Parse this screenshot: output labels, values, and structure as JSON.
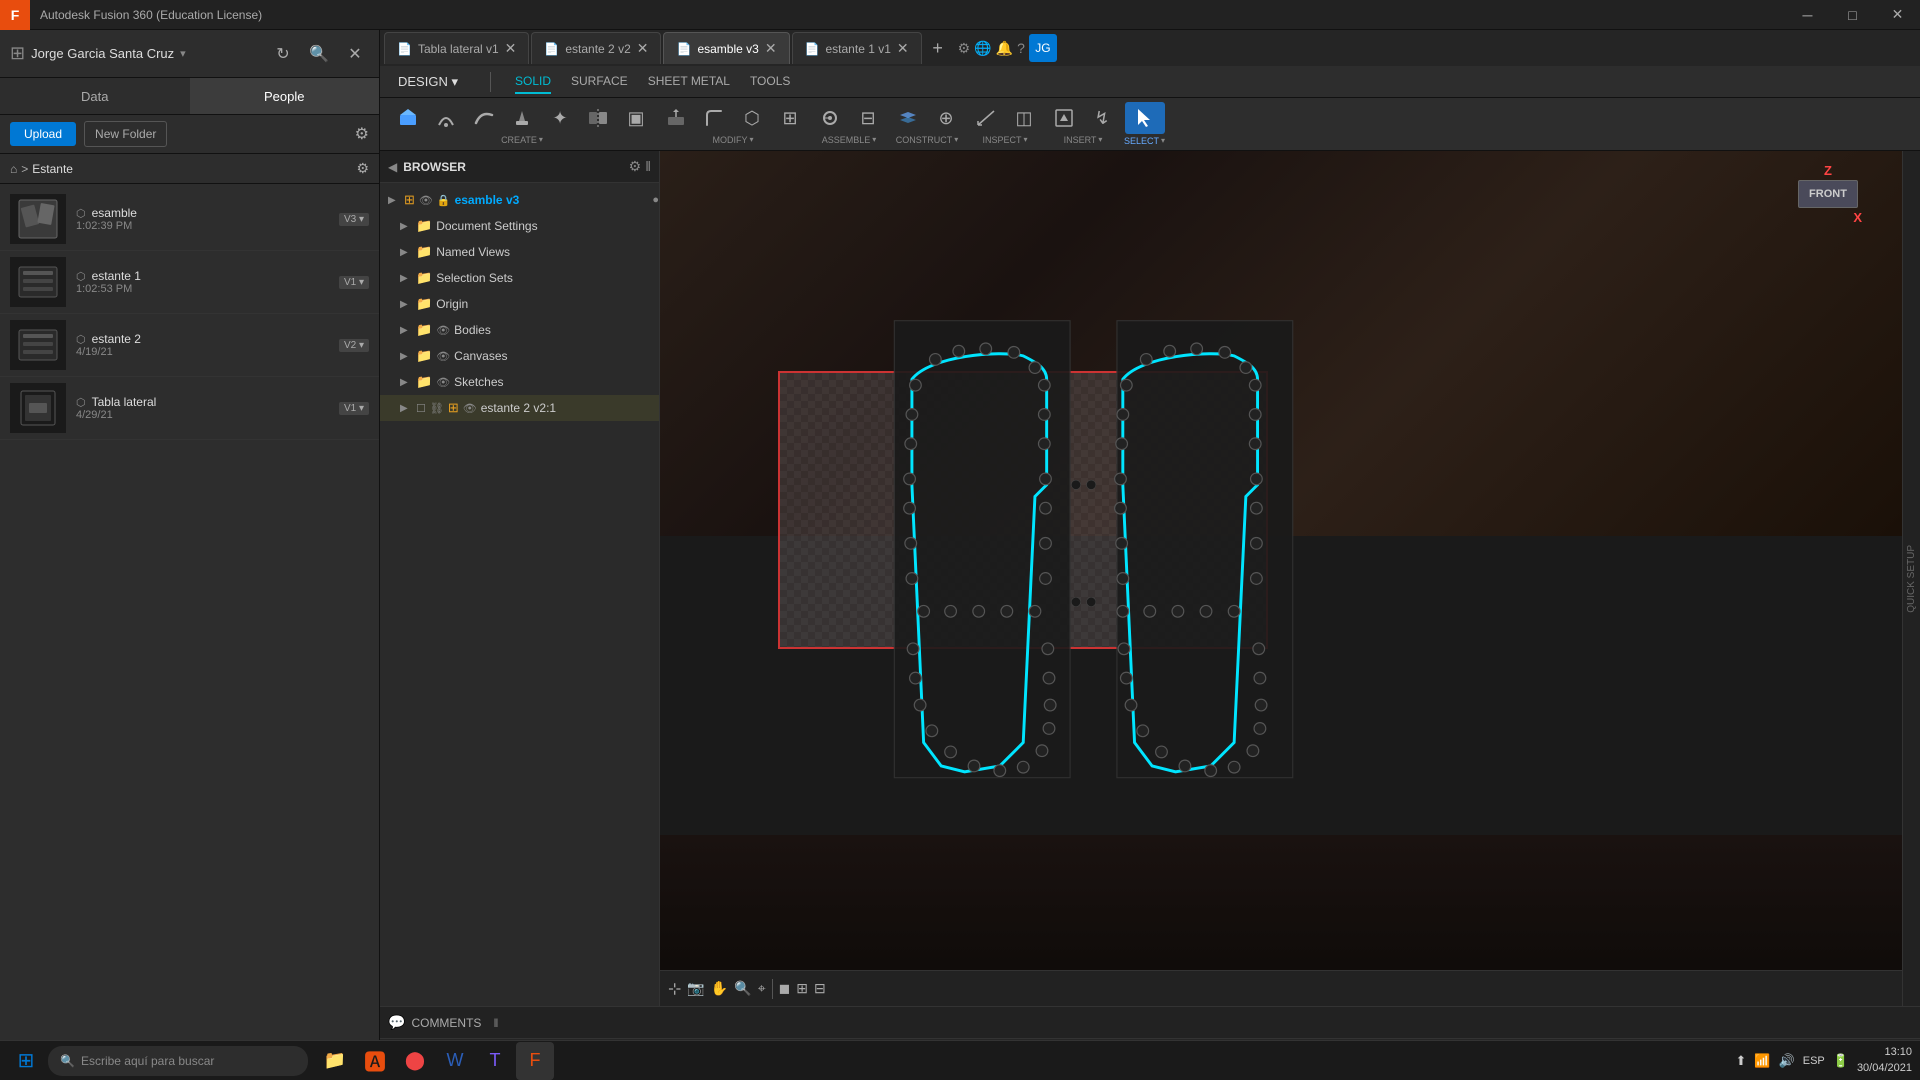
{
  "app": {
    "title": "Autodesk Fusion 360 (Education License)",
    "icon": "F"
  },
  "titlebar": {
    "title": "Autodesk Fusion 360 (Education License)",
    "minimize": "─",
    "maximize": "□",
    "close": "✕"
  },
  "user": {
    "name": "Jorge Garcia Santa Cruz",
    "caret": "▾"
  },
  "left_tabs": {
    "data": "Data",
    "people": "People"
  },
  "actions": {
    "upload": "Upload",
    "new_folder": "New Folder"
  },
  "breadcrumb": {
    "home": "⌂",
    "sep": ">",
    "folder": "Estante"
  },
  "files": [
    {
      "name": "esamble",
      "meta": "1:02:39 PM",
      "version": "V3"
    },
    {
      "name": "estante 1",
      "meta": "1:02:53 PM",
      "version": "V1"
    },
    {
      "name": "estante 2",
      "meta": "4/19/21",
      "version": "V2"
    },
    {
      "name": "Tabla lateral",
      "meta": "4/29/21",
      "version": "V1"
    }
  ],
  "tabs": [
    {
      "id": "tab1",
      "label": "Tabla lateral v1",
      "active": false
    },
    {
      "id": "tab2",
      "label": "estante 2 v2",
      "active": false
    },
    {
      "id": "tab3",
      "label": "esamble v3",
      "active": true
    },
    {
      "id": "tab4",
      "label": "estante 1 v1",
      "active": false
    }
  ],
  "mode_tabs": [
    {
      "label": "SOLID",
      "active": true
    },
    {
      "label": "SURFACE",
      "active": false
    },
    {
      "label": "SHEET METAL",
      "active": false
    },
    {
      "label": "TOOLS",
      "active": false
    }
  ],
  "design_btn": "DESIGN ▾",
  "toolbar_groups": [
    {
      "label": "CREATE",
      "buttons": [
        {
          "icon": "⬚",
          "label": ""
        },
        {
          "icon": "⬡",
          "label": ""
        },
        {
          "icon": "◯",
          "label": ""
        },
        {
          "icon": "◉",
          "label": ""
        },
        {
          "icon": "✦",
          "label": ""
        },
        {
          "icon": "⬕",
          "label": ""
        },
        {
          "icon": "▣",
          "label": ""
        }
      ]
    },
    {
      "label": "MODIFY",
      "buttons": [
        {
          "icon": "⧉",
          "label": ""
        },
        {
          "icon": "◈",
          "label": ""
        },
        {
          "icon": "⬡",
          "label": ""
        },
        {
          "icon": "⊞",
          "label": ""
        }
      ]
    },
    {
      "label": "ASSEMBLE",
      "buttons": [
        {
          "icon": "⚙",
          "label": ""
        },
        {
          "icon": "⊟",
          "label": ""
        }
      ]
    },
    {
      "label": "CONSTRUCT",
      "buttons": [
        {
          "icon": "⊘",
          "label": ""
        },
        {
          "icon": "⊕",
          "label": ""
        }
      ]
    },
    {
      "label": "INSPECT",
      "buttons": [
        {
          "icon": "📐",
          "label": ""
        },
        {
          "icon": "◫",
          "label": ""
        }
      ]
    },
    {
      "label": "INSERT",
      "buttons": [
        {
          "icon": "⊞",
          "label": ""
        },
        {
          "icon": "↯",
          "label": ""
        }
      ]
    },
    {
      "label": "SELECT",
      "active": true,
      "buttons": [
        {
          "icon": "↖",
          "label": "",
          "active": true
        }
      ]
    }
  ],
  "browser": {
    "title": "BROWSER",
    "root": "esamble v3",
    "items": [
      {
        "label": "Document Settings",
        "indent": 1,
        "arrow": "▶",
        "type": "folder"
      },
      {
        "label": "Named Views",
        "indent": 1,
        "arrow": "▶",
        "type": "folder"
      },
      {
        "label": "Selection Sets",
        "indent": 1,
        "arrow": "▶",
        "type": "folder"
      },
      {
        "label": "Origin",
        "indent": 1,
        "arrow": "▶",
        "type": "folder"
      },
      {
        "label": "Bodies",
        "indent": 1,
        "arrow": "▶",
        "type": "folder"
      },
      {
        "label": "Canvases",
        "indent": 1,
        "arrow": "▶",
        "type": "folder"
      },
      {
        "label": "Sketches",
        "indent": 1,
        "arrow": "▶",
        "type": "folder"
      },
      {
        "label": "estante 2 v2:1",
        "indent": 1,
        "arrow": "▶",
        "type": "component"
      }
    ]
  },
  "viewport": {
    "gizmo_front": "FRONT",
    "gizmo_z": "Z",
    "gizmo_x": "X"
  },
  "comments": {
    "label": "COMMENTS"
  },
  "timeline": {
    "items": 6
  },
  "right_gutter": {
    "label": "QUICK SETUP"
  },
  "taskbar": {
    "search_placeholder": "Escribe aquí para buscar",
    "time": "13:10",
    "date": "30/04/2021",
    "lang": "ESP",
    "apps": [
      "🪟",
      "🔍",
      "📁",
      "🅰",
      "⬤",
      "📝",
      "🦅",
      "🖥"
    ]
  }
}
